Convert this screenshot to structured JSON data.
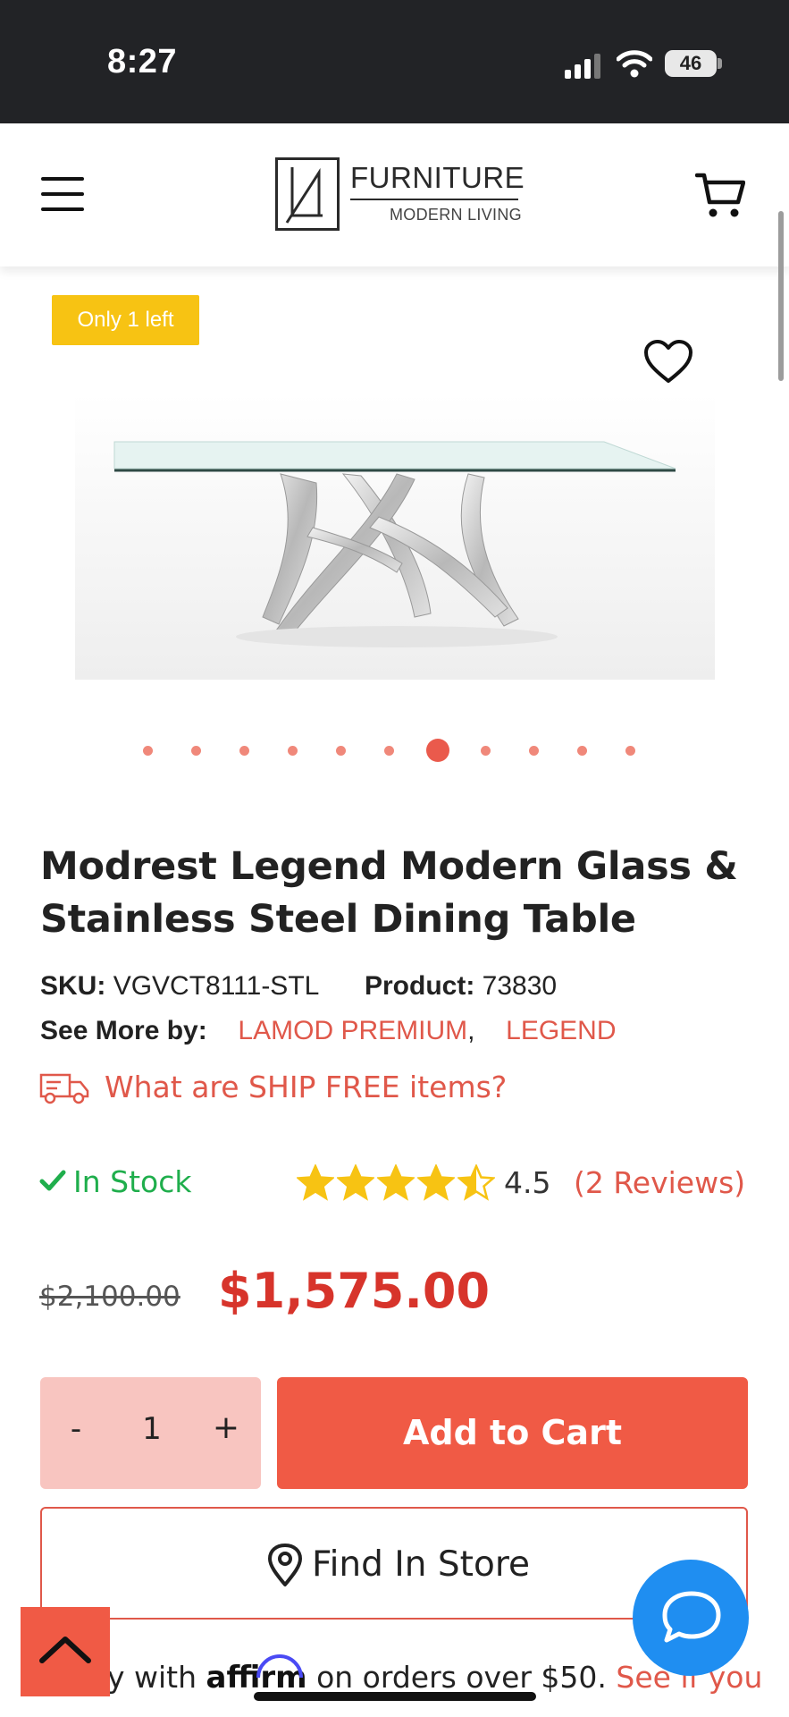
{
  "status_bar": {
    "time": "8:27",
    "battery": "46"
  },
  "header": {
    "logo_title": "FURNITURE",
    "logo_subtitle": "MODERN LIVING"
  },
  "product": {
    "badge": "Only 1 left",
    "carousel": {
      "count": 11,
      "active_index": 6
    },
    "title": "Modrest Legend Modern Glass & Stainless Steel Dining Table",
    "sku_label": "SKU:",
    "sku": "VGVCT8111-STL",
    "product_label": "Product:",
    "product_number": "73830",
    "see_more_label": "See More by:",
    "brands": [
      "LAMOD PREMIUM",
      "LEGEND"
    ],
    "brand_separator": ",",
    "ship_free_link": "What are SHIP FREE items?",
    "stock_status": "In Stock",
    "rating": 4.5,
    "rating_text": "4.5",
    "reviews_text": "(2  Reviews)",
    "old_price": "$2,100.00",
    "price": "$1,575.00",
    "quantity": "1",
    "qty_minus": "-",
    "qty_plus": "+",
    "add_to_cart": "Add to Cart",
    "find_in_store": "Find In Store",
    "affirm": {
      "prefix": "y with ",
      "logo": "affirm",
      "middle": " on orders over $50. ",
      "link": "See if you"
    }
  },
  "colors": {
    "accent": "#f05a45",
    "price": "#d7342b",
    "link": "#e0584a",
    "in_stock": "#1fae4c",
    "badge": "#f7c313",
    "star": "#f7c313",
    "chat": "#1f8ef1"
  },
  "icons": [
    "menu-icon",
    "cart-icon",
    "heart-icon",
    "zoom-in-icon",
    "truck-icon",
    "check-icon",
    "star-icon",
    "map-pin-icon",
    "chevron-up-icon",
    "chat-icon"
  ]
}
